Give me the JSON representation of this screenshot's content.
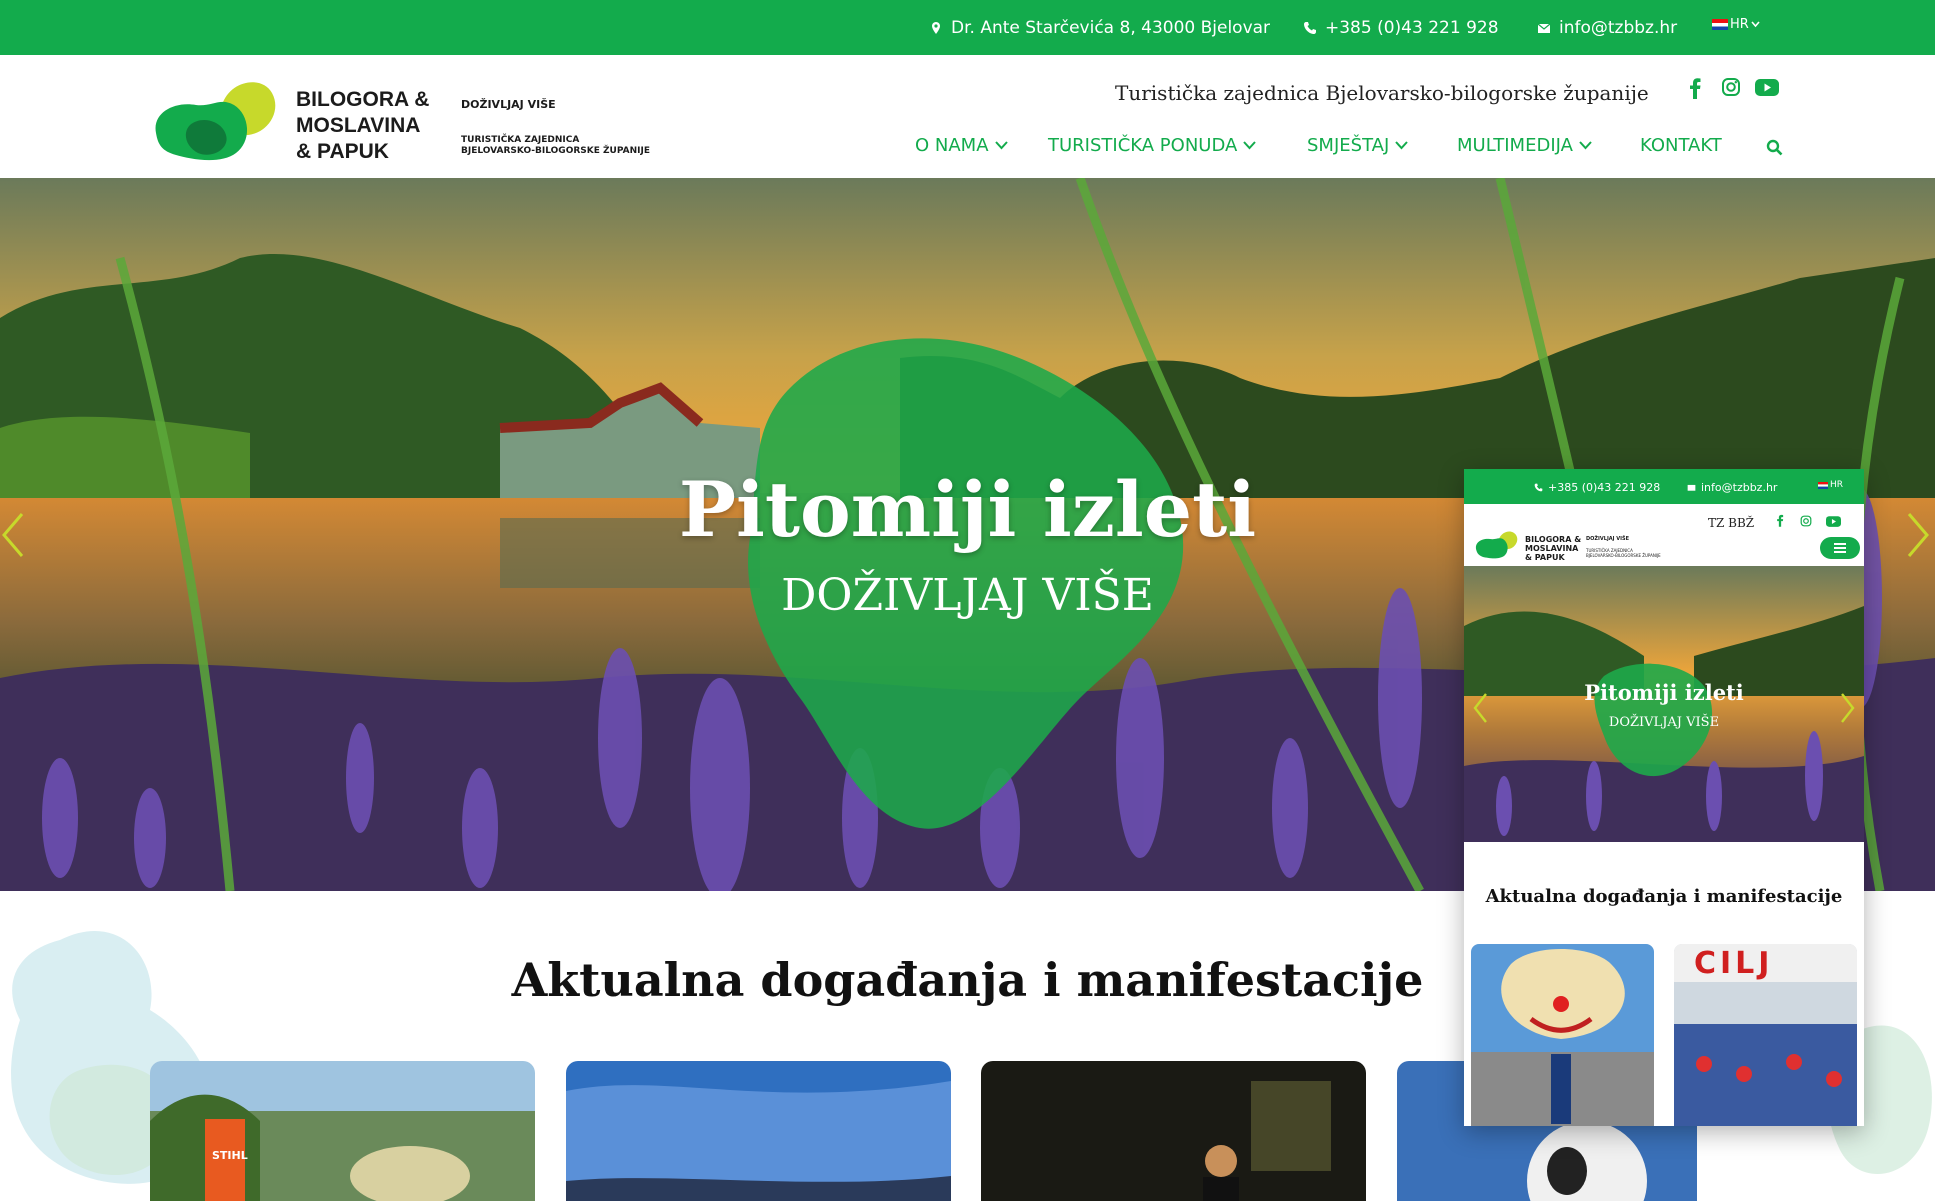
{
  "topbar": {
    "address": "Dr. Ante Starčevića 8, 43000 Bjelovar",
    "phone": "+385 (0)43 221 928",
    "email": "info@tzbbz.hr",
    "language": "HR"
  },
  "header": {
    "brand_line1": "BILOGORA &",
    "brand_line2": "MOSLAVINA",
    "brand_line3": "& PAPUK",
    "tagline": "DOŽIVLJAJ VIŠE",
    "org_small_line1": "TURISTIČKA ZAJEDNICA",
    "org_small_line2": "BJELOVARSKO-BILOGORSKE ŽUPANIJE",
    "org_title": "Turistička zajednica Bjelovarsko-bilogorske županije",
    "social_icons": [
      "facebook-icon",
      "instagram-icon",
      "youtube-icon"
    ]
  },
  "nav": {
    "items": [
      {
        "label": "O NAMA",
        "dropdown": true
      },
      {
        "label": "TURISTIČKA PONUDA",
        "dropdown": true
      },
      {
        "label": "SMJEŠTAJ",
        "dropdown": true
      },
      {
        "label": "MULTIMEDIJA",
        "dropdown": true
      },
      {
        "label": "KONTAKT",
        "dropdown": false
      }
    ]
  },
  "hero": {
    "title": "Pitomiji izleti",
    "subtitle": "DOŽIVLJAJ VIŠE"
  },
  "events": {
    "title": "Aktualna događanja i manifestacije"
  },
  "mobile": {
    "phone": "+385 (0)43 221 928",
    "email": "info@tzbbz.hr",
    "language": "HR",
    "org_short": "TZ BBŽ",
    "brand_line1": "BILOGORA &",
    "brand_line2": "MOSLAVINA",
    "brand_line3": "& PAPUK",
    "tagline": "DOŽIVLJAJ VIŠE",
    "org_small_line1": "TURISTIČKA ZAJEDNICA",
    "org_small_line2": "BJELOVARSKO-BILOGORSKE ŽUPANIJE",
    "hero_title": "Pitomiji izleti",
    "hero_subtitle": "DOŽIVLJAJ VIŠE",
    "events_title": "Aktualna događanja i manifestacije",
    "card2_sign": "CILJ"
  },
  "cards": {
    "card1_banner": "STIHL"
  },
  "colors": {
    "brand_green": "#13ab4c",
    "logo_lime": "#c7d92b",
    "logo_dark_green": "#0f7a3a"
  }
}
